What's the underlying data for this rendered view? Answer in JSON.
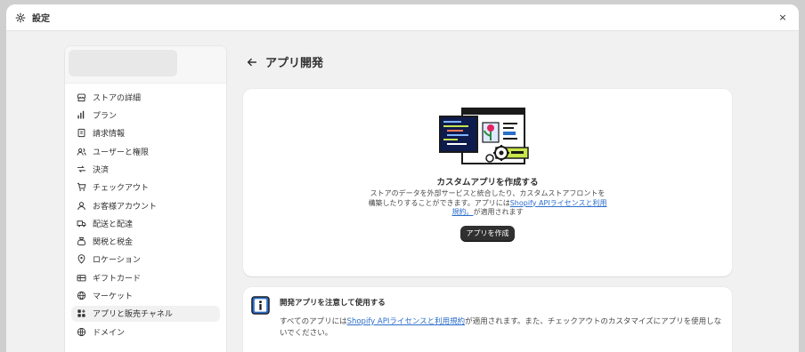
{
  "window": {
    "title": "設定",
    "close_label": "×"
  },
  "sidebar": {
    "items": [
      {
        "label": "ストアの詳細",
        "icon": "store-icon"
      },
      {
        "label": "プラン",
        "icon": "plan-icon"
      },
      {
        "label": "請求情報",
        "icon": "billing-icon"
      },
      {
        "label": "ユーザーと権限",
        "icon": "users-icon"
      },
      {
        "label": "決済",
        "icon": "payments-icon"
      },
      {
        "label": "チェックアウト",
        "icon": "checkout-icon"
      },
      {
        "label": "お客様アカウント",
        "icon": "customer-account-icon"
      },
      {
        "label": "配送と配達",
        "icon": "shipping-icon"
      },
      {
        "label": "関税と税金",
        "icon": "taxes-icon"
      },
      {
        "label": "ロケーション",
        "icon": "location-icon"
      },
      {
        "label": "ギフトカード",
        "icon": "gift-card-icon"
      },
      {
        "label": "マーケット",
        "icon": "markets-icon"
      },
      {
        "label": "アプリと販売チャネル",
        "icon": "apps-icon",
        "active": true
      },
      {
        "label": "ドメイン",
        "icon": "domain-icon"
      }
    ]
  },
  "page": {
    "title": "アプリ開発"
  },
  "custom_app_card": {
    "heading": "カスタムアプリを作成する",
    "desc_before": "ストアのデータを外部サービスと統合したり、カスタムストアフロントを構築したりすることができます。アプリには",
    "desc_link": "Shopify APIライセンスと利用規約。",
    "desc_after": "が適用されます",
    "button_label": "アプリを作成"
  },
  "notice_card": {
    "title": "開発アプリを注意して使用する",
    "body_before": "すべてのアプリには",
    "body_link": "Shopify APIライセンスと利用規約",
    "body_after": "が適用されます。また、チェックアウトのカスタマイズにアプリを使用しないでください。"
  },
  "colors": {
    "link": "#2c6ecb",
    "primary_button": "#303030",
    "accent_green": "#c8e64a"
  }
}
